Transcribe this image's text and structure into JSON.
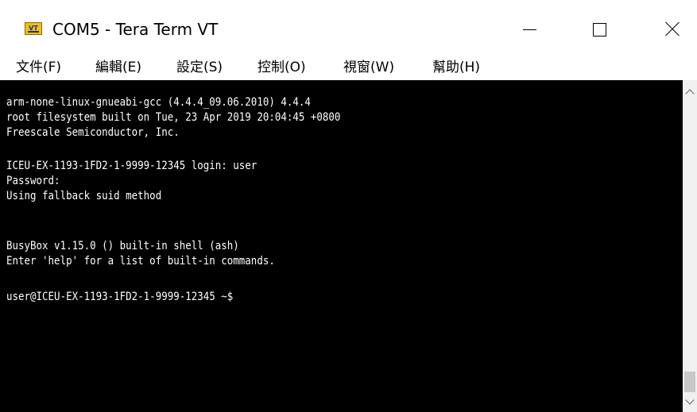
{
  "window": {
    "title": "COM5 - Tera Term VT",
    "icon": "tera-term-vt-icon",
    "icon_label": "VT"
  },
  "menu": {
    "items": [
      {
        "label": "文件(F)"
      },
      {
        "label": "編輯(E)"
      },
      {
        "label": "設定(S)"
      },
      {
        "label": "控制(O)"
      },
      {
        "label": "視窗(W)"
      },
      {
        "label": "幫助(H)"
      }
    ]
  },
  "terminal": {
    "background": "#000000",
    "foreground": "#ffffff",
    "lines": [
      "arm-none-linux-gnueabi-gcc (4.4.4_09.06.2010) 4.4.4",
      "root filesystem built on Tue, 23 Apr 2019 20:04:45 +0800",
      "Freescale Semiconductor, Inc.",
      "",
      "ICEU-EX-1193-1FD2-1-9999-12345 login: user",
      "Password:",
      "Using fallback suid method",
      "",
      "",
      "BusyBox v1.15.0 () built-in shell (ash)",
      "Enter 'help' for a list of built-in commands.",
      "",
      "user@ICEU-EX-1193-1FD2-1-9999-12345 ~$"
    ]
  },
  "controls": {
    "minimize": "minimize-icon",
    "maximize": "maximize-icon",
    "close": "close-icon"
  }
}
